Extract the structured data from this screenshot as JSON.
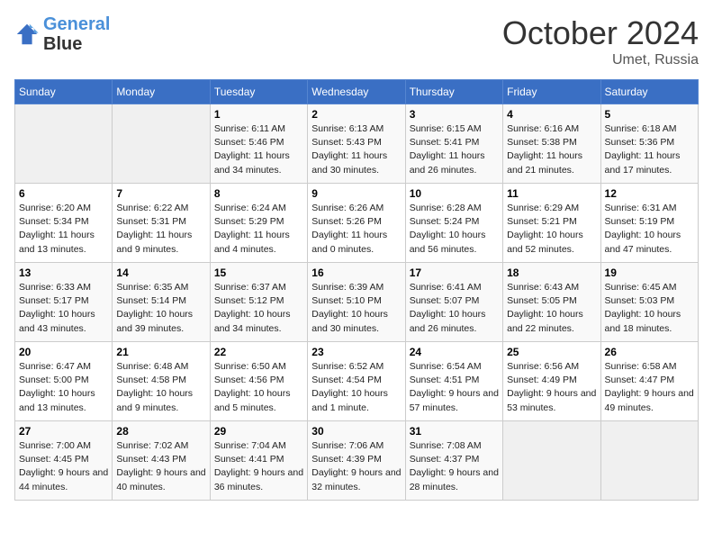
{
  "logo": {
    "line1": "General",
    "line2": "Blue"
  },
  "title": "October 2024",
  "subtitle": "Umet, Russia",
  "days_of_week": [
    "Sunday",
    "Monday",
    "Tuesday",
    "Wednesday",
    "Thursday",
    "Friday",
    "Saturday"
  ],
  "weeks": [
    [
      {
        "day": "",
        "sunrise": "",
        "sunset": "",
        "daylight": ""
      },
      {
        "day": "",
        "sunrise": "",
        "sunset": "",
        "daylight": ""
      },
      {
        "day": "1",
        "sunrise": "Sunrise: 6:11 AM",
        "sunset": "Sunset: 5:46 PM",
        "daylight": "Daylight: 11 hours and 34 minutes."
      },
      {
        "day": "2",
        "sunrise": "Sunrise: 6:13 AM",
        "sunset": "Sunset: 5:43 PM",
        "daylight": "Daylight: 11 hours and 30 minutes."
      },
      {
        "day": "3",
        "sunrise": "Sunrise: 6:15 AM",
        "sunset": "Sunset: 5:41 PM",
        "daylight": "Daylight: 11 hours and 26 minutes."
      },
      {
        "day": "4",
        "sunrise": "Sunrise: 6:16 AM",
        "sunset": "Sunset: 5:38 PM",
        "daylight": "Daylight: 11 hours and 21 minutes."
      },
      {
        "day": "5",
        "sunrise": "Sunrise: 6:18 AM",
        "sunset": "Sunset: 5:36 PM",
        "daylight": "Daylight: 11 hours and 17 minutes."
      }
    ],
    [
      {
        "day": "6",
        "sunrise": "Sunrise: 6:20 AM",
        "sunset": "Sunset: 5:34 PM",
        "daylight": "Daylight: 11 hours and 13 minutes."
      },
      {
        "day": "7",
        "sunrise": "Sunrise: 6:22 AM",
        "sunset": "Sunset: 5:31 PM",
        "daylight": "Daylight: 11 hours and 9 minutes."
      },
      {
        "day": "8",
        "sunrise": "Sunrise: 6:24 AM",
        "sunset": "Sunset: 5:29 PM",
        "daylight": "Daylight: 11 hours and 4 minutes."
      },
      {
        "day": "9",
        "sunrise": "Sunrise: 6:26 AM",
        "sunset": "Sunset: 5:26 PM",
        "daylight": "Daylight: 11 hours and 0 minutes."
      },
      {
        "day": "10",
        "sunrise": "Sunrise: 6:28 AM",
        "sunset": "Sunset: 5:24 PM",
        "daylight": "Daylight: 10 hours and 56 minutes."
      },
      {
        "day": "11",
        "sunrise": "Sunrise: 6:29 AM",
        "sunset": "Sunset: 5:21 PM",
        "daylight": "Daylight: 10 hours and 52 minutes."
      },
      {
        "day": "12",
        "sunrise": "Sunrise: 6:31 AM",
        "sunset": "Sunset: 5:19 PM",
        "daylight": "Daylight: 10 hours and 47 minutes."
      }
    ],
    [
      {
        "day": "13",
        "sunrise": "Sunrise: 6:33 AM",
        "sunset": "Sunset: 5:17 PM",
        "daylight": "Daylight: 10 hours and 43 minutes."
      },
      {
        "day": "14",
        "sunrise": "Sunrise: 6:35 AM",
        "sunset": "Sunset: 5:14 PM",
        "daylight": "Daylight: 10 hours and 39 minutes."
      },
      {
        "day": "15",
        "sunrise": "Sunrise: 6:37 AM",
        "sunset": "Sunset: 5:12 PM",
        "daylight": "Daylight: 10 hours and 34 minutes."
      },
      {
        "day": "16",
        "sunrise": "Sunrise: 6:39 AM",
        "sunset": "Sunset: 5:10 PM",
        "daylight": "Daylight: 10 hours and 30 minutes."
      },
      {
        "day": "17",
        "sunrise": "Sunrise: 6:41 AM",
        "sunset": "Sunset: 5:07 PM",
        "daylight": "Daylight: 10 hours and 26 minutes."
      },
      {
        "day": "18",
        "sunrise": "Sunrise: 6:43 AM",
        "sunset": "Sunset: 5:05 PM",
        "daylight": "Daylight: 10 hours and 22 minutes."
      },
      {
        "day": "19",
        "sunrise": "Sunrise: 6:45 AM",
        "sunset": "Sunset: 5:03 PM",
        "daylight": "Daylight: 10 hours and 18 minutes."
      }
    ],
    [
      {
        "day": "20",
        "sunrise": "Sunrise: 6:47 AM",
        "sunset": "Sunset: 5:00 PM",
        "daylight": "Daylight: 10 hours and 13 minutes."
      },
      {
        "day": "21",
        "sunrise": "Sunrise: 6:48 AM",
        "sunset": "Sunset: 4:58 PM",
        "daylight": "Daylight: 10 hours and 9 minutes."
      },
      {
        "day": "22",
        "sunrise": "Sunrise: 6:50 AM",
        "sunset": "Sunset: 4:56 PM",
        "daylight": "Daylight: 10 hours and 5 minutes."
      },
      {
        "day": "23",
        "sunrise": "Sunrise: 6:52 AM",
        "sunset": "Sunset: 4:54 PM",
        "daylight": "Daylight: 10 hours and 1 minute."
      },
      {
        "day": "24",
        "sunrise": "Sunrise: 6:54 AM",
        "sunset": "Sunset: 4:51 PM",
        "daylight": "Daylight: 9 hours and 57 minutes."
      },
      {
        "day": "25",
        "sunrise": "Sunrise: 6:56 AM",
        "sunset": "Sunset: 4:49 PM",
        "daylight": "Daylight: 9 hours and 53 minutes."
      },
      {
        "day": "26",
        "sunrise": "Sunrise: 6:58 AM",
        "sunset": "Sunset: 4:47 PM",
        "daylight": "Daylight: 9 hours and 49 minutes."
      }
    ],
    [
      {
        "day": "27",
        "sunrise": "Sunrise: 7:00 AM",
        "sunset": "Sunset: 4:45 PM",
        "daylight": "Daylight: 9 hours and 44 minutes."
      },
      {
        "day": "28",
        "sunrise": "Sunrise: 7:02 AM",
        "sunset": "Sunset: 4:43 PM",
        "daylight": "Daylight: 9 hours and 40 minutes."
      },
      {
        "day": "29",
        "sunrise": "Sunrise: 7:04 AM",
        "sunset": "Sunset: 4:41 PM",
        "daylight": "Daylight: 9 hours and 36 minutes."
      },
      {
        "day": "30",
        "sunrise": "Sunrise: 7:06 AM",
        "sunset": "Sunset: 4:39 PM",
        "daylight": "Daylight: 9 hours and 32 minutes."
      },
      {
        "day": "31",
        "sunrise": "Sunrise: 7:08 AM",
        "sunset": "Sunset: 4:37 PM",
        "daylight": "Daylight: 9 hours and 28 minutes."
      },
      {
        "day": "",
        "sunrise": "",
        "sunset": "",
        "daylight": ""
      },
      {
        "day": "",
        "sunrise": "",
        "sunset": "",
        "daylight": ""
      }
    ]
  ]
}
